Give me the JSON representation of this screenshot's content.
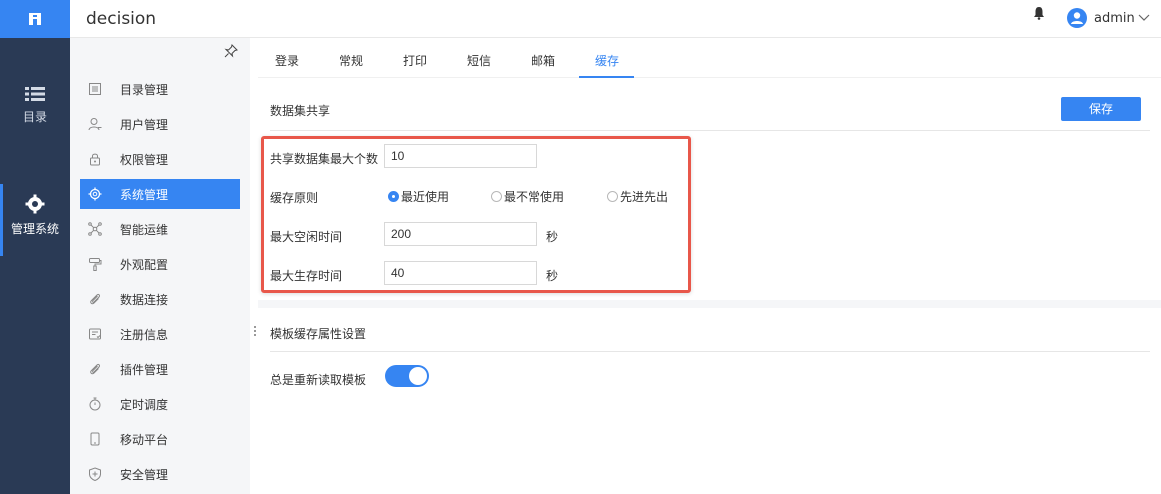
{
  "app": {
    "title": "decision"
  },
  "user": {
    "name": "admin"
  },
  "rail": {
    "catalog_label": "目录",
    "admin_label": "管理系统"
  },
  "nav": {
    "items": [
      {
        "label": "目录管理",
        "icon": "catalog-list-icon"
      },
      {
        "label": "用户管理",
        "icon": "user-icon"
      },
      {
        "label": "权限管理",
        "icon": "lock-icon"
      },
      {
        "label": "系统管理",
        "icon": "gear-icon",
        "active": true
      },
      {
        "label": "智能运维",
        "icon": "network-icon"
      },
      {
        "label": "外观配置",
        "icon": "paint-roller-icon"
      },
      {
        "label": "数据连接",
        "icon": "link-icon"
      },
      {
        "label": "注册信息",
        "icon": "register-icon"
      },
      {
        "label": "插件管理",
        "icon": "plugin-icon"
      },
      {
        "label": "定时调度",
        "icon": "timer-icon"
      },
      {
        "label": "移动平台",
        "icon": "mobile-icon"
      },
      {
        "label": "安全管理",
        "icon": "shield-icon"
      }
    ]
  },
  "tabs": [
    {
      "label": "登录"
    },
    {
      "label": "常规"
    },
    {
      "label": "打印"
    },
    {
      "label": "短信"
    },
    {
      "label": "邮箱"
    },
    {
      "label": "缓存",
      "active": true
    }
  ],
  "dataset_share": {
    "title": "数据集共享",
    "save_label": "保存",
    "max_count_label": "共享数据集最大个数",
    "max_count_value": "10",
    "policy_label": "缓存原则",
    "policy_options": [
      {
        "label": "最近使用",
        "checked": true
      },
      {
        "label": "最不常使用",
        "checked": false
      },
      {
        "label": "先进先出",
        "checked": false
      }
    ],
    "max_idle_label": "最大空闲时间",
    "max_idle_value": "200",
    "max_idle_unit": "秒",
    "max_live_label": "最大生存时间",
    "max_live_value": "40",
    "max_live_unit": "秒"
  },
  "template_cache": {
    "title": "模板缓存属性设置",
    "always_reload_label": "总是重新读取模板",
    "always_reload_on": true
  },
  "colors": {
    "accent": "#3685f2",
    "rail_bg": "#2a3a55",
    "highlight_border": "#e8574a"
  }
}
